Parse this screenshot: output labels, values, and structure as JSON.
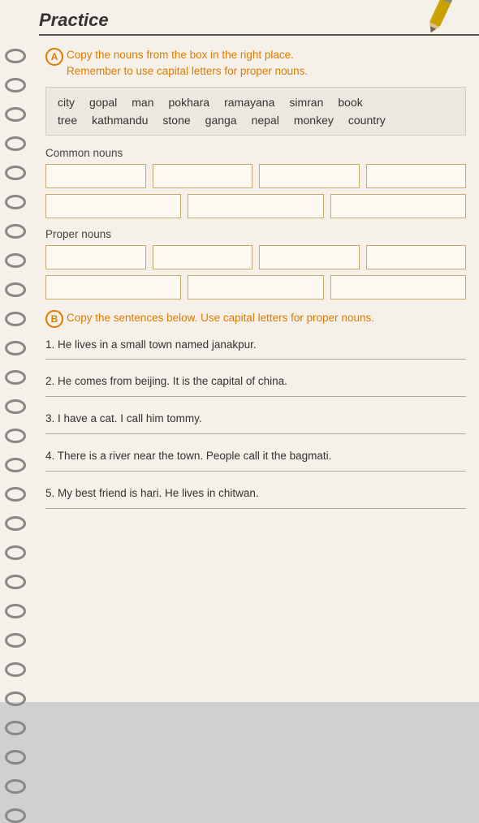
{
  "page": {
    "title": "Practice"
  },
  "sectionA": {
    "badge": "A",
    "instruction_line1": "Copy the nouns from the box in the right place.",
    "instruction_line2": "Remember to use capital letters for proper nouns.",
    "word_row1": [
      "city",
      "gopal",
      "man",
      "pokhara",
      "ramayana",
      "simran",
      "book"
    ],
    "word_row2": [
      "tree",
      "kathmandu",
      "stone",
      "ganga",
      "nepal",
      "monkey",
      "country"
    ],
    "common_label": "Common nouns",
    "proper_label": "Proper nouns"
  },
  "sectionB": {
    "badge": "B",
    "instruction": "Copy the sentences below. Use capital letters for proper nouns.",
    "sentences": [
      "1. He lives in a small town named janakpur.",
      "2. He comes from beijing. It is the capital of china.",
      "3. I have a cat. I call him tommy.",
      "4. There is a river near the town. People call it the bagmati.",
      "5. My best friend is hari. He lives in chitwan."
    ]
  },
  "icons": {
    "pencil": "✏️",
    "pencil_unicode": "✎"
  }
}
